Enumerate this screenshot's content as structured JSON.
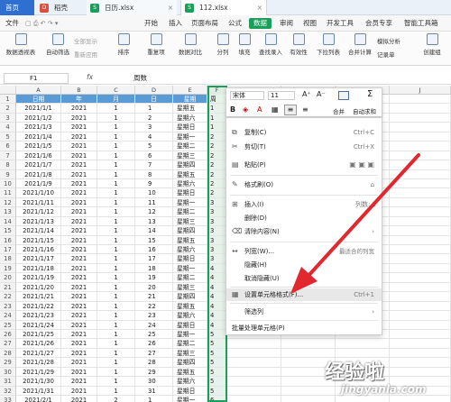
{
  "tabs": {
    "home": "首页",
    "t1": "稻壳",
    "t2": "日历.xlsx",
    "t3": "112.xlsx"
  },
  "menu": [
    "文件",
    "开始",
    "插入",
    "页面布局",
    "公式",
    "数据",
    "审阅",
    "视图",
    "开发工具",
    "会员专享",
    "智能工具箱"
  ],
  "menu_active": "数据",
  "ribbon": {
    "items": [
      "数据透视表",
      "自动筛选",
      "排序",
      "重复项",
      "数据对比",
      "分列",
      "填充",
      "查找录入",
      "有效性",
      "下拉列表",
      "合并计算",
      "记录单",
      "创建组"
    ],
    "small": [
      "全部显示",
      "重新应用",
      "模拟分析"
    ]
  },
  "formula": {
    "name": "F1",
    "fx": "fx",
    "value": "周数"
  },
  "columns": [
    "A",
    "B",
    "C",
    "D",
    "E",
    "F",
    "G",
    "H",
    "I",
    "J"
  ],
  "headers": {
    "a": "日期",
    "b": "年",
    "c": "月",
    "d": "日",
    "e": "星期",
    "f": "周"
  },
  "rows": [
    [
      "1",
      "",
      "",
      "",
      "",
      "",
      ""
    ],
    [
      "2",
      "2021/1/1",
      "2021",
      "1",
      "1",
      "星期五",
      "1"
    ],
    [
      "3",
      "2021/1/2",
      "2021",
      "1",
      "2",
      "星期六",
      "1"
    ],
    [
      "4",
      "2021/1/3",
      "2021",
      "1",
      "3",
      "星期日",
      "1"
    ],
    [
      "5",
      "2021/1/4",
      "2021",
      "1",
      "4",
      "星期一",
      "2"
    ],
    [
      "6",
      "2021/1/5",
      "2021",
      "1",
      "5",
      "星期二",
      "2"
    ],
    [
      "7",
      "2021/1/6",
      "2021",
      "1",
      "6",
      "星期三",
      "2"
    ],
    [
      "8",
      "2021/1/7",
      "2021",
      "1",
      "7",
      "星期四",
      "2"
    ],
    [
      "9",
      "2021/1/8",
      "2021",
      "1",
      "8",
      "星期五",
      "2"
    ],
    [
      "10",
      "2021/1/9",
      "2021",
      "1",
      "9",
      "星期六",
      "2"
    ],
    [
      "11",
      "2021/1/10",
      "2021",
      "1",
      "10",
      "星期日",
      "2"
    ],
    [
      "12",
      "2021/1/11",
      "2021",
      "1",
      "11",
      "星期一",
      "3"
    ],
    [
      "13",
      "2021/1/12",
      "2021",
      "1",
      "12",
      "星期二",
      "3"
    ],
    [
      "14",
      "2021/1/13",
      "2021",
      "1",
      "13",
      "星期三",
      "3"
    ],
    [
      "15",
      "2021/1/14",
      "2021",
      "1",
      "14",
      "星期四",
      "3"
    ],
    [
      "16",
      "2021/1/15",
      "2021",
      "1",
      "15",
      "星期五",
      "3"
    ],
    [
      "17",
      "2021/1/16",
      "2021",
      "1",
      "16",
      "星期六",
      "3"
    ],
    [
      "18",
      "2021/1/17",
      "2021",
      "1",
      "17",
      "星期日",
      "3"
    ],
    [
      "19",
      "2021/1/18",
      "2021",
      "1",
      "18",
      "星期一",
      "4"
    ],
    [
      "20",
      "2021/1/19",
      "2021",
      "1",
      "19",
      "星期二",
      "4"
    ],
    [
      "21",
      "2021/1/20",
      "2021",
      "1",
      "20",
      "星期三",
      "4"
    ],
    [
      "22",
      "2021/1/21",
      "2021",
      "1",
      "21",
      "星期四",
      "4"
    ],
    [
      "23",
      "2021/1/22",
      "2021",
      "1",
      "22",
      "星期五",
      "4"
    ],
    [
      "24",
      "2021/1/23",
      "2021",
      "1",
      "23",
      "星期六",
      "4"
    ],
    [
      "25",
      "2021/1/24",
      "2021",
      "1",
      "24",
      "星期日",
      "4"
    ],
    [
      "26",
      "2021/1/25",
      "2021",
      "1",
      "25",
      "星期一",
      "5"
    ],
    [
      "27",
      "2021/1/26",
      "2021",
      "1",
      "26",
      "星期二",
      "5"
    ],
    [
      "28",
      "2021/1/27",
      "2021",
      "1",
      "27",
      "星期三",
      "5"
    ],
    [
      "29",
      "2021/1/28",
      "2021",
      "1",
      "28",
      "星期四",
      "5"
    ],
    [
      "30",
      "2021/1/29",
      "2021",
      "1",
      "29",
      "星期五",
      "5"
    ],
    [
      "31",
      "2021/1/30",
      "2021",
      "1",
      "30",
      "星期六",
      "5"
    ],
    [
      "32",
      "2021/1/31",
      "2021",
      "1",
      "31",
      "星期日",
      "5"
    ],
    [
      "33",
      "2021/2/1",
      "2021",
      "2",
      "1",
      "星期一",
      "6"
    ],
    [
      "34",
      "2021/2/2",
      "2021",
      "2",
      "2",
      "星期二",
      "6"
    ]
  ],
  "minitoolbar": {
    "font": "宋体",
    "size": "11",
    "merge": "合并",
    "autosum": "自动求和"
  },
  "context_menu": [
    {
      "icon": "copy",
      "label": "复制(C)",
      "shortcut": "Ctrl+C"
    },
    {
      "icon": "cut",
      "label": "剪切(T)",
      "shortcut": "Ctrl+X"
    },
    {
      "icon": "paste",
      "label": "粘贴(P)",
      "shortcut": ""
    },
    {
      "icon": "brush",
      "label": "格式刷(O)",
      "shortcut": ""
    },
    {
      "icon": "insert",
      "label": "插入(I)",
      "shortcut": "列数: 1"
    },
    {
      "icon": "delete",
      "label": "删除(D)",
      "shortcut": ""
    },
    {
      "icon": "clear",
      "label": "清除内容(N)",
      "shortcut": ""
    },
    {
      "icon": "colwidth",
      "label": "列宽(W)...",
      "shortcut": "最适合的列宽"
    },
    {
      "icon": "hide",
      "label": "隐藏(H)",
      "shortcut": ""
    },
    {
      "icon": "unhide",
      "label": "取消隐藏(U)",
      "shortcut": ""
    },
    {
      "icon": "format",
      "label": "设置单元格格式(F)...",
      "shortcut": "Ctrl+1"
    },
    {
      "icon": "filter",
      "label": "筛选列",
      "shortcut": ""
    },
    {
      "icon": "batch",
      "label": "批量处理单元格(P)",
      "shortcut": ""
    }
  ],
  "watermark": {
    "line1": "经验啦",
    "line2": "jingyanla.com"
  },
  "colors": {
    "accent": "#1a9e5a",
    "header_fill": "#5b9bd5",
    "arrow": "#e0282e",
    "tab_home": "#2f6fd0"
  }
}
